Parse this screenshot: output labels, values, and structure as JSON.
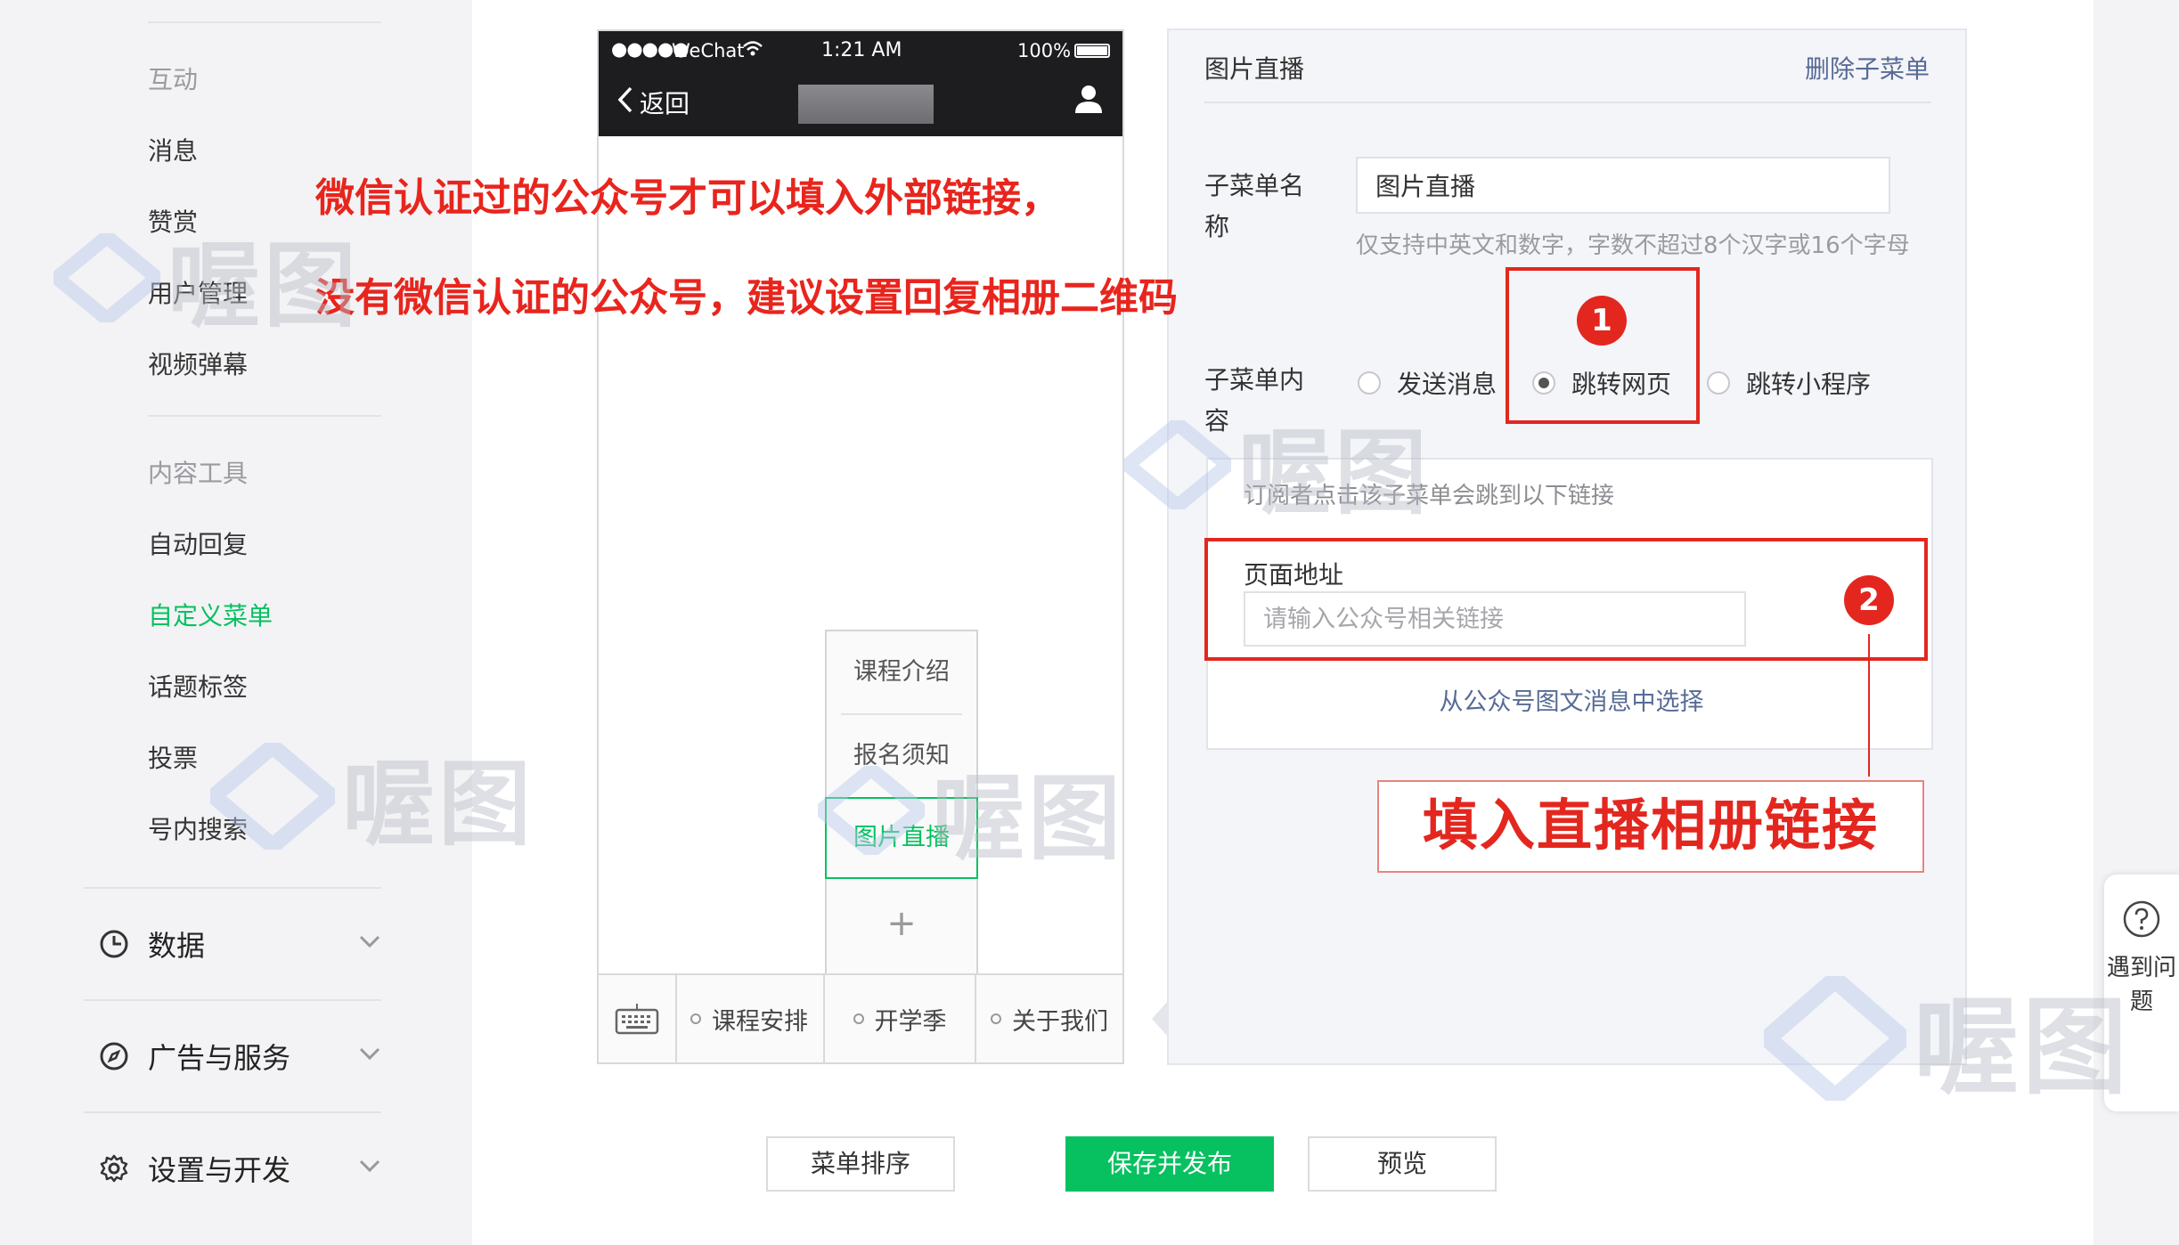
{
  "sidebar": {
    "interact_section": "互动",
    "interact_items": [
      "消息",
      "赞赏",
      "用户管理",
      "视频弹幕"
    ],
    "content_section": "内容工具",
    "content_items": [
      "自动回复",
      "自定义菜单",
      "话题标签",
      "投票",
      "号内搜索"
    ],
    "groups": [
      {
        "label": "数据",
        "icon": "clock-icon"
      },
      {
        "label": "广告与服务",
        "icon": "compass-icon"
      },
      {
        "label": "设置与开发",
        "icon": "gear-icon"
      }
    ]
  },
  "phone": {
    "signal": "●●●●●",
    "carrier": "WeChat",
    "time": "1:21 AM",
    "battery": "100%",
    "back_label": "返回",
    "submenu": [
      "课程介绍",
      "报名须知",
      "图片直播"
    ],
    "submenu_add": "+",
    "tabs": [
      "课程安排",
      "开学季",
      "关于我们"
    ]
  },
  "panel": {
    "title": "图片直播",
    "delete_label": "删除子菜单",
    "name_label": "子菜单名称",
    "name_value": "图片直播",
    "name_hint": "仅支持中英文和数字，字数不超过8个汉字或16个字母",
    "content_label": "子菜单内容",
    "radios": [
      "发送消息",
      "跳转网页",
      "跳转小程序"
    ],
    "selected_radio": "跳转网页",
    "link_hint": "订阅者点击该子菜单会跳到以下链接",
    "address_label": "页面地址",
    "address_placeholder": "请输入公众号相关链接",
    "choose_link": "从公众号图文消息中选择"
  },
  "annotations": {
    "line1": "微信认证过的公众号才可以填入外部链接，",
    "line2": "没有微信认证的公众号，建议设置回复相册二维码",
    "badge1": "1",
    "badge2": "2",
    "callout": "填入直播相册链接",
    "accent_color": "#e3271f"
  },
  "buttons": {
    "sort": "菜单排序",
    "save": "保存并发布",
    "preview": "预览"
  },
  "help": {
    "icon": "question-icon",
    "text": "遇到问题"
  },
  "watermark": {
    "text": "喔图"
  },
  "colors": {
    "green": "#07c160",
    "link": "#576b95"
  }
}
